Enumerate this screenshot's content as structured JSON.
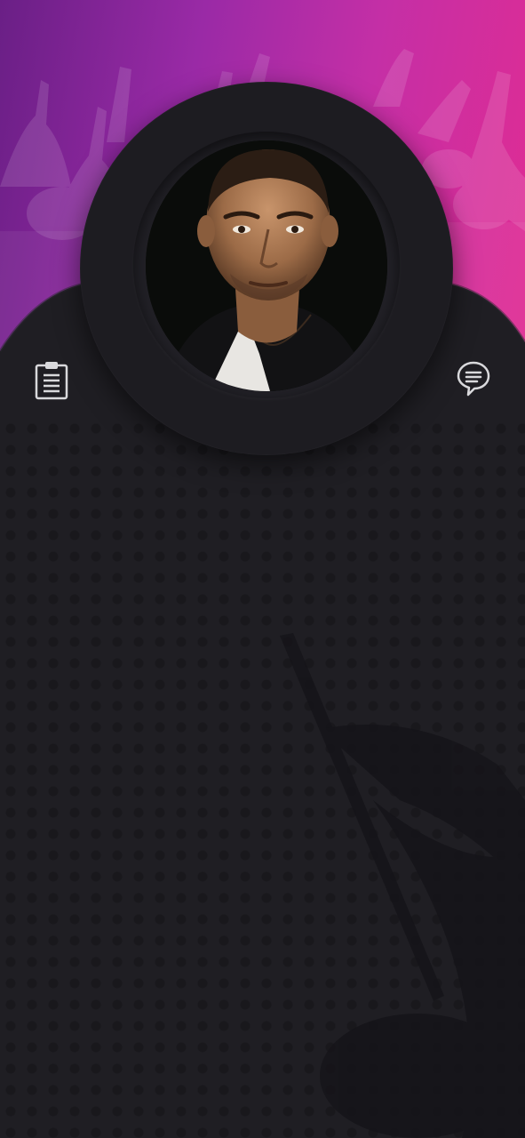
{
  "screen": {
    "background_color": "#1f1e23",
    "banner_gradient": [
      "#6a1f86",
      "#9a2aa6",
      "#c42fa6",
      "#e02c93"
    ]
  },
  "profile": {
    "avatar": "artist-portrait-photo"
  },
  "actions": {
    "left_icon": "clipboard-list-icon",
    "right_icon": "chat-bubble-icon",
    "icon_color": "#d9d9dc"
  }
}
